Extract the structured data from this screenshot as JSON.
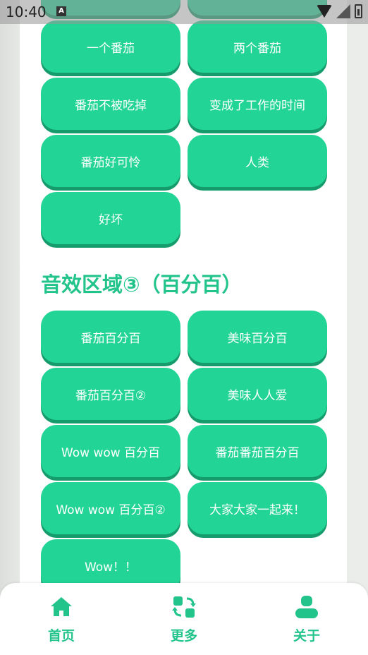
{
  "status_bar": {
    "time": "10:40",
    "a_icon": "A"
  },
  "buttons_top_partial": [
    "",
    ""
  ],
  "buttons_group2": [
    "一个番茄",
    "两个番茄",
    "番茄不被吃掉",
    "变成了工作的时间",
    "番茄好可怜",
    "人类",
    "好坏"
  ],
  "section3": {
    "title": "音效区域③（百分百）",
    "buttons": [
      "番茄百分百",
      "美味百分百",
      "番茄百分百②",
      "美味人人爱",
      "Wow wow 百分百",
      "番茄番茄百分百",
      "Wow wow 百分百②",
      "大家大家一起来！",
      "Wow！！"
    ]
  },
  "bottom_nav": {
    "items": [
      {
        "label": "首页",
        "icon": "home-icon"
      },
      {
        "label": "更多",
        "icon": "swap-icon"
      },
      {
        "label": "关于",
        "icon": "person-icon"
      }
    ]
  },
  "colors": {
    "accent": "#23d497",
    "accent_shadow": "#169b6c",
    "title": "#22c48b"
  }
}
